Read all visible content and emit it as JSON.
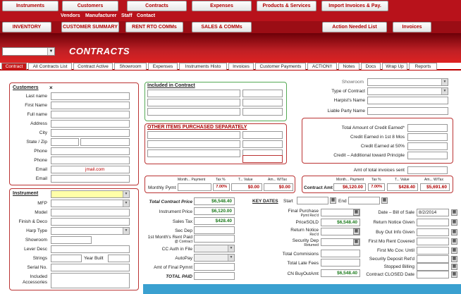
{
  "nav_top": [
    "Instruments",
    "Customers",
    "Contracts",
    "Expenses",
    "Products & Services",
    "Import Invoices & Pay."
  ],
  "nav_sub": [
    "Vendors",
    "Manufacturer",
    "Staff",
    "Contact"
  ],
  "nav_second": [
    "INVENTORY",
    "CUSTOMER SUMMARY",
    "RENT RTO COMMs",
    "SALES & COMMs",
    "Action Needed List",
    "Invoices"
  ],
  "page_title": "CONTRACTS",
  "tabs": [
    "Contract",
    "All Contracts List",
    "Contract Active",
    "Showroom",
    "Expenses",
    "Instruments Histo",
    "Invoices",
    "Customer Payments",
    "ACTION!!",
    "Notes",
    "Docs",
    "Wrap Up",
    "Reports"
  ],
  "customers": {
    "title": "Customers",
    "close": "×",
    "labels": [
      "Last name",
      "First Name",
      "Full name",
      "Address",
      "City",
      "State / Zip",
      "Phone",
      "Phone",
      "Email",
      "Email"
    ],
    "email_value": "jmail.com"
  },
  "instrument": {
    "title": "Instrument",
    "labels": [
      "MFP",
      "Model",
      "Finish & Deco",
      "Harp Type",
      "Showroom",
      "Lever Desc",
      "Strings",
      "Serial No.",
      "Included Accessories"
    ],
    "year_built_label": "Year Built"
  },
  "included": {
    "title": "Included in Contract"
  },
  "other_items": {
    "title": "OTHER ITEMS PURCHASED SEPARATELY"
  },
  "right_top": {
    "labels": [
      "Showroom",
      "Type of Contract",
      "Harpist's Name",
      "Liable Party Name"
    ]
  },
  "credit": {
    "labels": [
      "Total Amount of Credit Earned*",
      "Credit Earned in 1st 8 Mos",
      "Credit Earned at 50%",
      "Credit – Additional toward Principle"
    ],
    "amt_invoices_label": "Amt of total invoices sent"
  },
  "monthly": {
    "label": "Monthly Pymt",
    "col_headers": [
      "Month... Payment",
      "Tax %",
      "T... Value",
      "Am... W/Tax"
    ],
    "tax": "7.00%",
    "t_value": "$0.00",
    "am_wtax": "$0.00"
  },
  "contract_amt": {
    "label": "Contract Amt",
    "col_headers": [
      "Month... Payment",
      "Tax %",
      "T... Value",
      "Am... W/Tax"
    ],
    "payment": "$6,120.00",
    "tax": "7.00%",
    "t_value": "$428.40",
    "am_wtax": "$5,691.60"
  },
  "pricing": {
    "labels": [
      "Total Contract Price",
      "Instrument Price",
      "Sales Tax",
      "Sec Dep",
      "1st Month's Rent Paid",
      "CC Auth in File",
      "AutoPay",
      "Amt of Final Pymnt",
      "TOTAL PAID"
    ],
    "rent_sub": "@ Contract",
    "total_contract_price": "$6,548.40",
    "instrument_price": "$6,120.00",
    "sales_tax": "$428.40"
  },
  "key_dates": {
    "title": "KEY DATES",
    "start": "Start",
    "end": "End"
  },
  "final": {
    "labels": [
      "Final Purchase",
      "PriceSOLD",
      "Return Notice",
      "Security Dep",
      "Total Commisions",
      "Total Late Fees",
      "CN BuyOutAmt"
    ],
    "sub_final": "Pymt Rec'd",
    "sub_return": "Rec'd",
    "sub_secdep": "Returned",
    "price_sold": "$6,548.40",
    "cn_buyout": "$6,548.40"
  },
  "dates_right": {
    "labels": [
      "Date – Bill of Sale",
      "Return Notice Given",
      "Buy Out Info Given",
      "First Mo Rent Covered",
      "First Mo Cov. Until",
      "Security Deposit Ret'd",
      "Stopped Billing",
      "Contract CLOSED Date"
    ],
    "bill_of_sale": "8/2/2014"
  },
  "colors": {
    "brand": "#b8121b",
    "accent_green": "#1a7a1a"
  }
}
